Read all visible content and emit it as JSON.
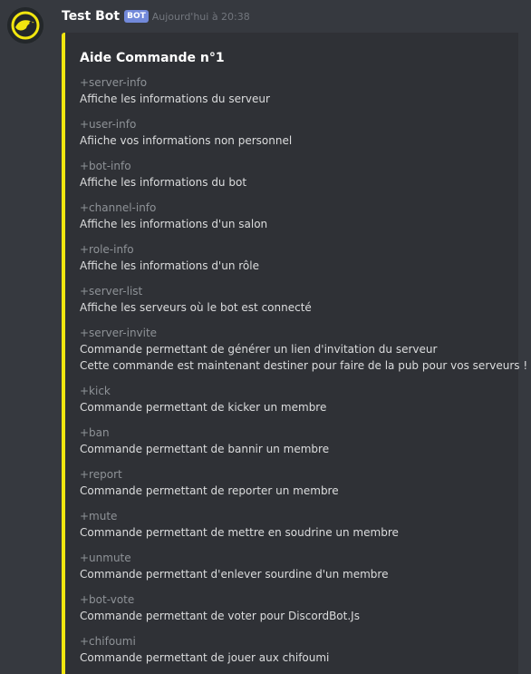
{
  "message": {
    "username": "Test Bot",
    "bot_tag": "BOT",
    "timestamp": "Aujourd'hui à 20:38"
  },
  "embed": {
    "accent_color": "#f1e60f",
    "title": "Aide Commande n°1",
    "fields": [
      {
        "name": "+server-info",
        "lines": [
          "Affiche les informations du serveur"
        ]
      },
      {
        "name": "+user-info",
        "lines": [
          "Afiiche vos informations non personnel"
        ]
      },
      {
        "name": "+bot-info",
        "lines": [
          "Affiche les informations du bot"
        ]
      },
      {
        "name": "+channel-info",
        "lines": [
          "Affiche les informations d'un salon"
        ]
      },
      {
        "name": "+role-info",
        "lines": [
          "Affiche les informations d'un rôle"
        ]
      },
      {
        "name": "+server-list",
        "lines": [
          "Affiche les serveurs où le bot est connecté"
        ]
      },
      {
        "name": "+server-invite",
        "lines": [
          "Commande permettant de générer un lien d'invitation du serveur",
          "Cette commande est maintenant destiner pour faire de la pub pour vos serveurs !"
        ]
      },
      {
        "name": "+kick",
        "lines": [
          "Commande permettant de kicker un membre"
        ]
      },
      {
        "name": "+ban",
        "lines": [
          "Commande permettant de bannir un membre"
        ]
      },
      {
        "name": "+report",
        "lines": [
          "Commande permettant de reporter un membre"
        ]
      },
      {
        "name": "+mute",
        "lines": [
          "Commande permettant de mettre en soudrine un membre"
        ]
      },
      {
        "name": "+unmute",
        "lines": [
          "Commande permettant d'enlever sourdine d'un membre"
        ]
      },
      {
        "name": "+bot-vote",
        "lines": [
          "Commande permettant de voter pour DiscordBot.Js"
        ]
      },
      {
        "name": "+chifoumi",
        "lines": [
          "Commande permettant de jouer aux chifoumi"
        ]
      }
    ]
  },
  "icons": {
    "avatar": "bot-avatar-icon"
  }
}
